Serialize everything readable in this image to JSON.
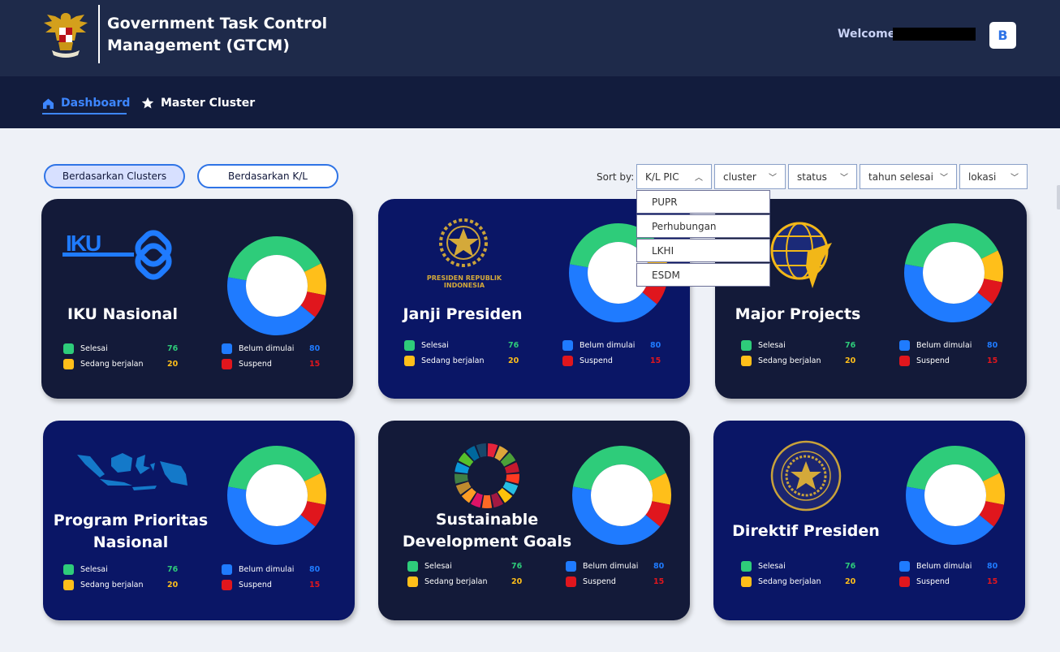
{
  "header": {
    "title": "Government Task Control Management (GTCM)",
    "welcome": "Welcome,",
    "avatar_letter": "B"
  },
  "nav": {
    "dashboard": "Dashboard",
    "master_cluster": "Master Cluster"
  },
  "toggle": {
    "by_clusters": "Berdasarkan Clusters",
    "by_kl": "Berdasarkan K/L"
  },
  "sort": {
    "label": "Sort by:",
    "filters": [
      "K/L PIC",
      "cluster",
      "status",
      "tahun selesai",
      "lokasi"
    ],
    "kl_options": [
      "PUPR",
      "Perhubungan",
      "LKHI",
      "ESDM"
    ]
  },
  "colors": {
    "selesai": "#2ecc7a",
    "sedang": "#ffbf1a",
    "belum": "#1f7bff",
    "suspend": "#e0161d"
  },
  "legend_labels": {
    "selesai": "Selesai",
    "sedang": "Sedang berjalan",
    "belum": "Belum dimulai",
    "suspend": "Suspend"
  },
  "cards": [
    {
      "title": "IKU Nasional",
      "icon": "iku-key-icon",
      "theme": "dark",
      "stats": {
        "selesai": 76,
        "sedang": 20,
        "belum": 80,
        "suspend": 15
      }
    },
    {
      "title": "Janji Presiden",
      "icon": "presidential-seal-icon",
      "logo_text": "PRESIDEN REPUBLIK INDONESIA",
      "theme": "navy",
      "stats": {
        "selesai": 76,
        "sedang": 20,
        "belum": 80,
        "suspend": 15
      }
    },
    {
      "title": "Major Projects",
      "icon": "transport-globe-icon",
      "theme": "dark",
      "stats": {
        "selesai": 76,
        "sedang": 20,
        "belum": 80,
        "suspend": 15
      }
    },
    {
      "title": "Program Prioritas Nasional",
      "icon": "indonesia-map-icon",
      "theme": "navy",
      "stats": {
        "selesai": 76,
        "sedang": 20,
        "belum": 80,
        "suspend": 15
      }
    },
    {
      "title": "Sustainable Development Goals",
      "icon": "sdg-wheel-icon",
      "theme": "dark",
      "stats": {
        "selesai": 76,
        "sedang": 20,
        "belum": 80,
        "suspend": 15
      }
    },
    {
      "title": "Direktif Presiden",
      "icon": "president-stamp-icon",
      "theme": "navy",
      "stats": {
        "selesai": 76,
        "sedang": 20,
        "belum": 80,
        "suspend": 15
      }
    }
  ]
}
